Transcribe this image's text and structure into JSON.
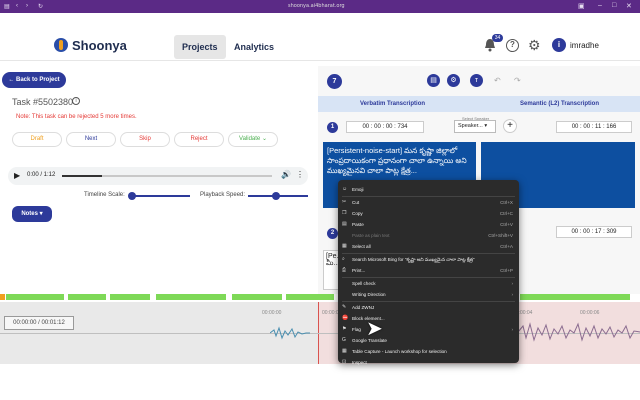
{
  "browser": {
    "url": "shoonya.ai4bharat.org"
  },
  "header": {
    "logo_text": "Shoonya",
    "nav": [
      "Projects",
      "Analytics"
    ],
    "notif_count": "34",
    "avatar_letter": "i",
    "username": "imradhe"
  },
  "left": {
    "back_label": "Back to Project",
    "task_title": "Task #5502380",
    "note": "Note: This task can be rejected 5 more times.",
    "actions": [
      "Draft",
      "Next",
      "Skip",
      "Reject",
      "Validate"
    ],
    "audio_time": "0:00 / 1:12",
    "timeline_label": "Timeline Scale:",
    "speed_label": "Playback Speed:",
    "notes_label": "Notes"
  },
  "right": {
    "page_num": "7",
    "col_verbatim": "Verbatim Transcription",
    "col_semantic": "Semantic (L2) Transcription",
    "row1": {
      "num": "1",
      "start": "00 : 00 : 00 : 734",
      "end": "00 : 00 : 11 : 166",
      "speaker_label": "Select Speaker",
      "speaker_value": "Speaker...",
      "text": "[Persistent-noise-start] మన కృష్ణా జిల్లాలో సాంప్రదాయికంగా ప్రధానంగా చాలా ఉన్నాయి అని ముఖ్యమైనవి చాలా పాట్ల క్షేత్ర..."
    },
    "row2": {
      "num": "2",
      "end": "00 : 00 : 17 : 309",
      "text": "[Pe... మీ..."
    }
  },
  "waveform": {
    "time_display": "00:00:00 / 00:01:12",
    "ticks": [
      "00:00:00",
      "00:00:02",
      "00:00:04",
      "00:00:06"
    ]
  },
  "context_menu": [
    {
      "label": "Emoji",
      "shortcut": "",
      "icon": "emoji-icon"
    },
    {
      "label": "Cut",
      "shortcut": "Ctrl+X",
      "icon": "cut-icon"
    },
    {
      "label": "Copy",
      "shortcut": "Ctrl+C",
      "icon": "copy-icon"
    },
    {
      "label": "Paste",
      "shortcut": "Ctrl+V",
      "icon": "paste-icon"
    },
    {
      "label": "Paste as plain text",
      "shortcut": "Ctrl+Shift+V",
      "icon": "",
      "dim": true
    },
    {
      "label": "Select all",
      "shortcut": "Ctrl+A",
      "icon": "select-all-icon"
    },
    {
      "label": "Search Microsoft Bing for \"కృష్ణా అని ముఖ్యమైన చాలా పాట్ల క్షేత్ర\"",
      "shortcut": "",
      "icon": "search-icon"
    },
    {
      "label": "Print...",
      "shortcut": "Ctrl+P",
      "icon": "print-icon"
    },
    {
      "label": "Spell check",
      "shortcut": "›",
      "icon": ""
    },
    {
      "label": "Writing Direction",
      "shortcut": "›",
      "icon": ""
    },
    {
      "label": "Add ZWNJ",
      "shortcut": "",
      "icon": "zwnj-icon"
    },
    {
      "label": "Block element...",
      "shortcut": "",
      "icon": "block-icon"
    },
    {
      "label": "Flag",
      "shortcut": "›",
      "icon": "flag-icon"
    },
    {
      "label": "Google Translate",
      "shortcut": "",
      "icon": "translate-icon"
    },
    {
      "label": "Table Capture - Launch workshop for selection",
      "shortcut": "",
      "icon": "table-icon"
    },
    {
      "label": "Inspect",
      "shortcut": "",
      "icon": "inspect-icon"
    }
  ]
}
